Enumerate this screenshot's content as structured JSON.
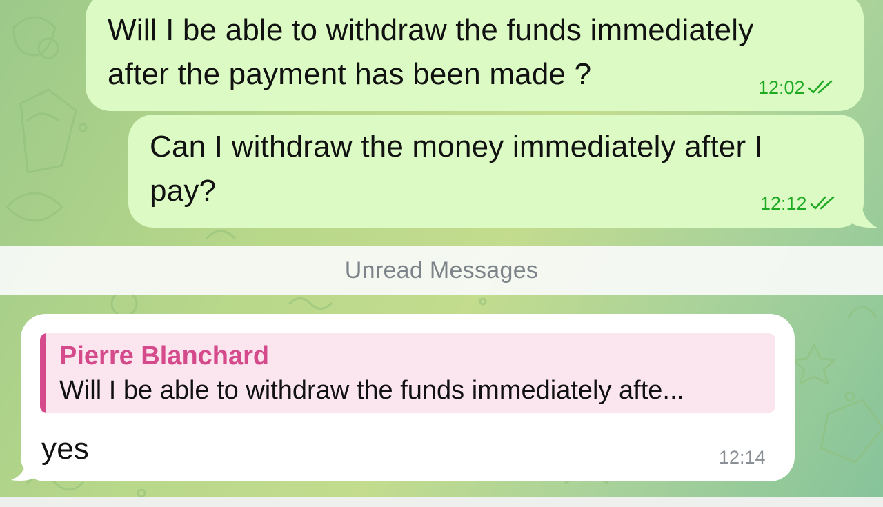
{
  "messages": [
    {
      "text": "Will I be able to withdraw the funds immediately\nafter the payment has been made ?",
      "time": "12:02",
      "status_icon": "double-check-icon",
      "direction": "outgoing"
    },
    {
      "text": "Can I withdraw the money immediately after I\npay?",
      "time": "12:12",
      "status_icon": "double-check-icon",
      "direction": "outgoing"
    }
  ],
  "unread_label": "Unread Messages",
  "incoming": {
    "reply_to": {
      "name": "Pierre Blanchard",
      "text": "Will I be able to withdraw the funds immediately afte..."
    },
    "text": "yes",
    "time": "12:14"
  },
  "colors": {
    "outgoing_bubble": "#dcfbc4",
    "incoming_bubble": "#ffffff",
    "outgoing_meta": "#1faa24",
    "reply_accent": "#d54a8b",
    "reply_background": "#fbe6ef"
  }
}
